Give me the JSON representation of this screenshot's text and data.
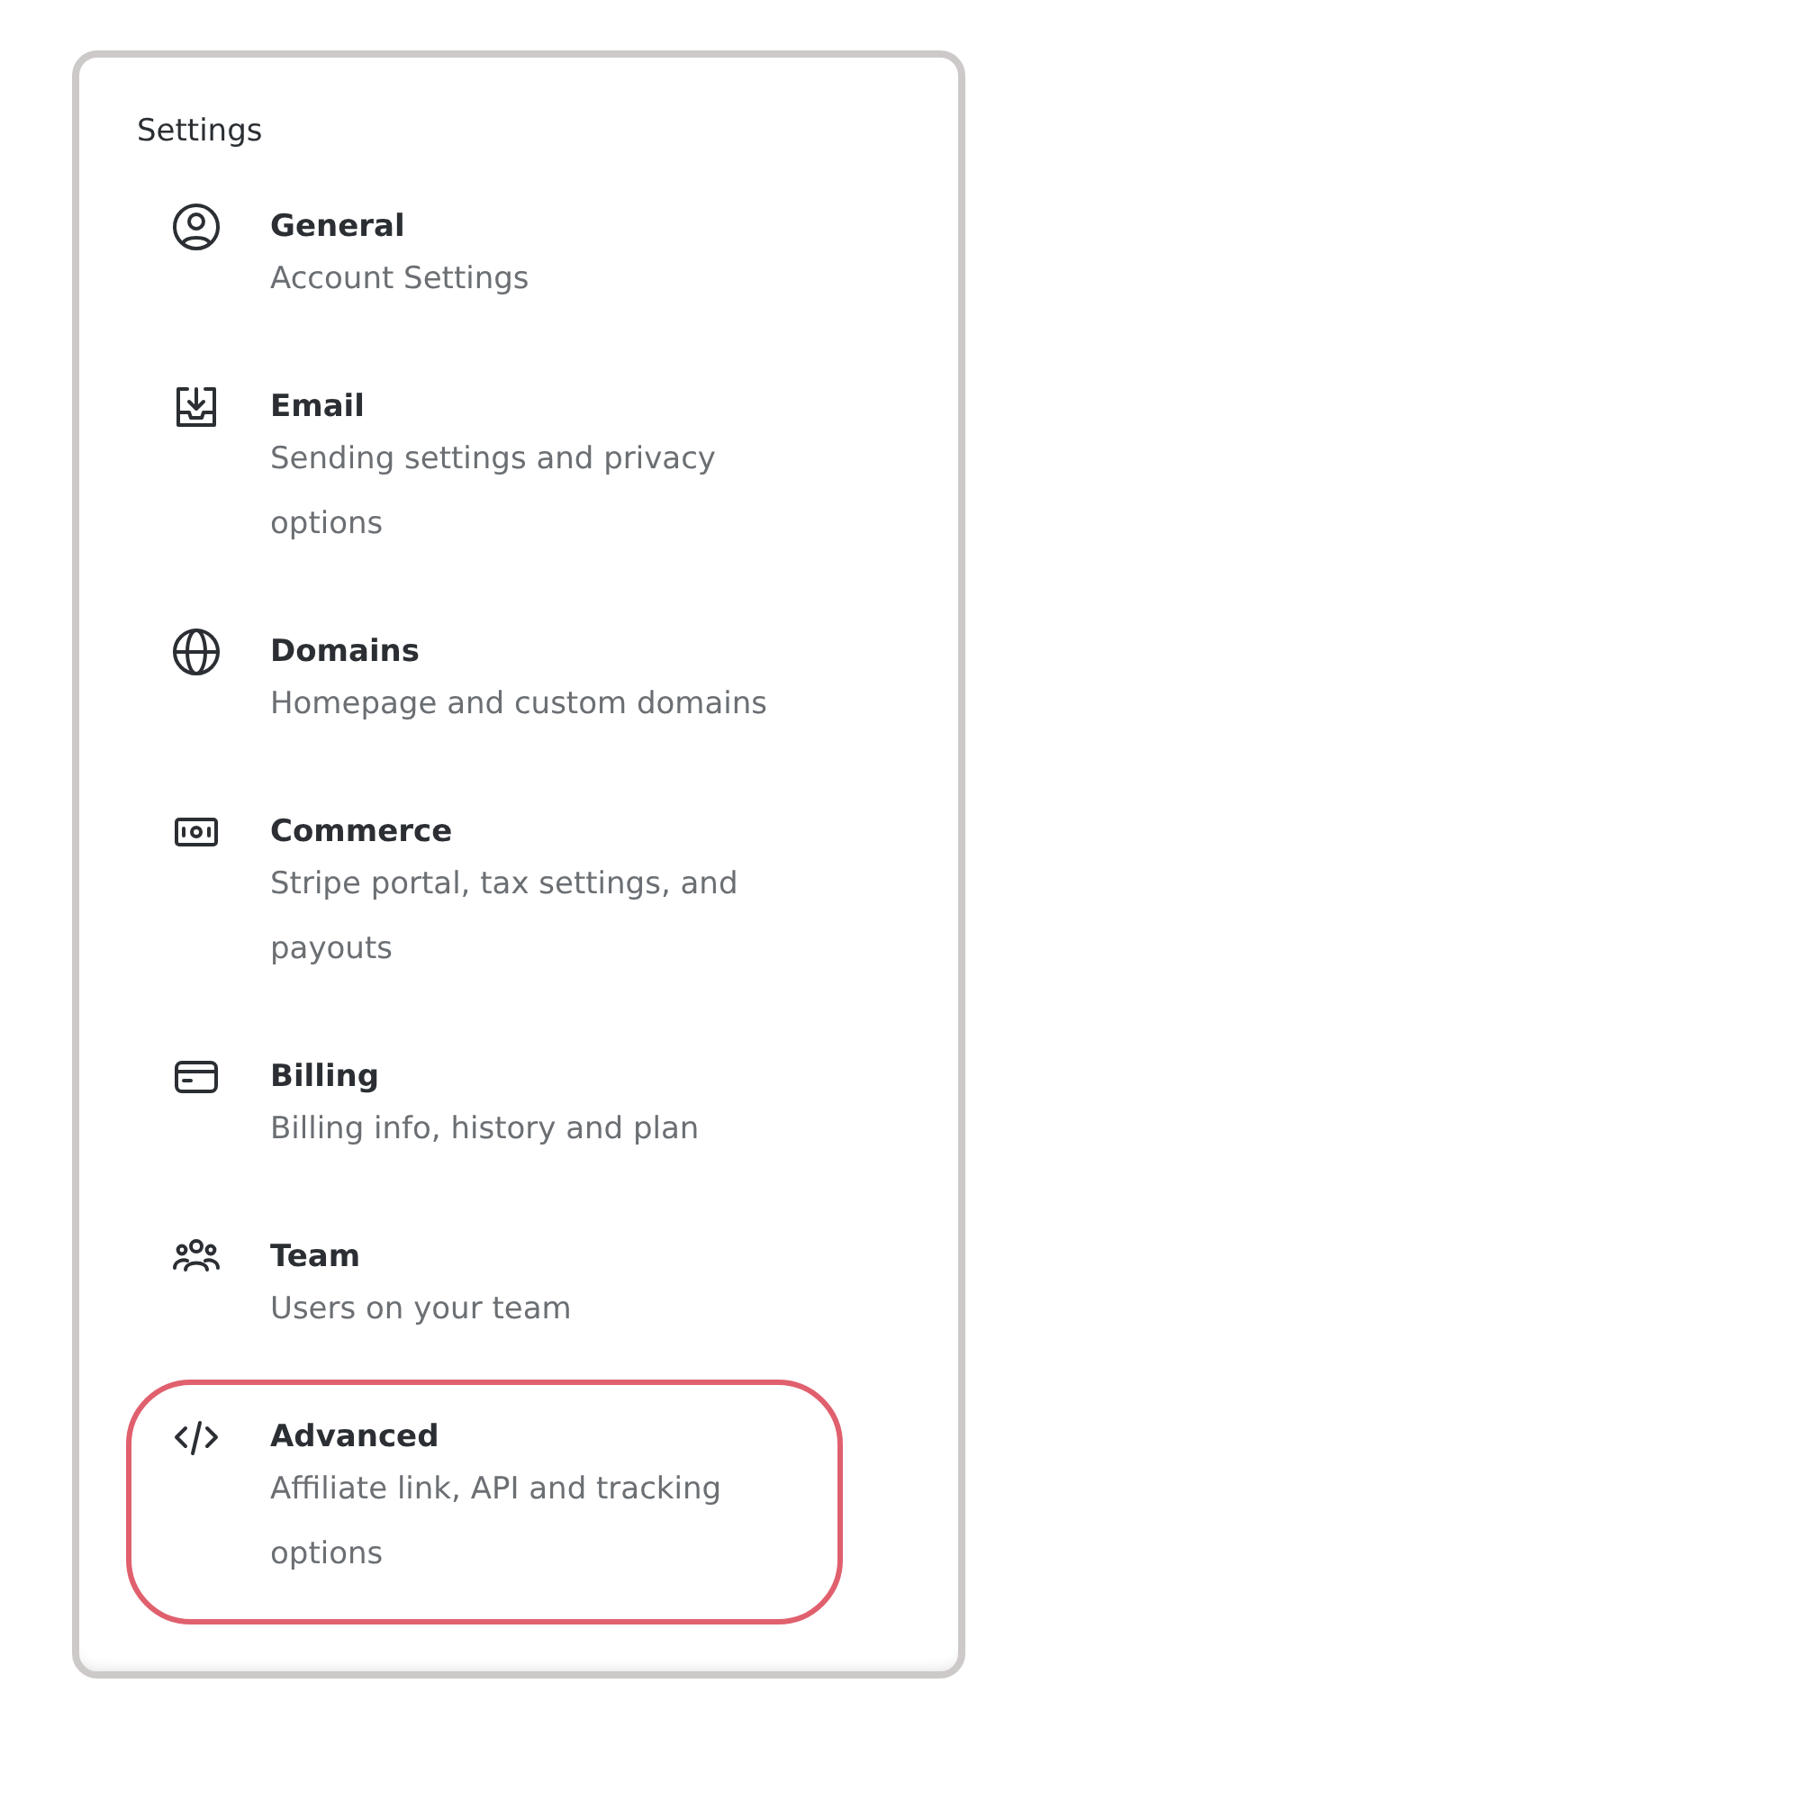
{
  "panel": {
    "title": "Settings",
    "items": [
      {
        "label": "General",
        "description": "Account Settings",
        "highlighted": false
      },
      {
        "label": "Email",
        "description": "Sending settings and privacy options",
        "highlighted": false
      },
      {
        "label": "Domains",
        "description": "Homepage and custom domains",
        "highlighted": false
      },
      {
        "label": "Commerce",
        "description": "Stripe portal, tax settings, and payouts",
        "highlighted": false
      },
      {
        "label": "Billing",
        "description": "Billing info, history and plan",
        "highlighted": false
      },
      {
        "label": "Team",
        "description": "Users on your team",
        "highlighted": false
      },
      {
        "label": "Advanced",
        "description": "Affiliate link, API and tracking options",
        "highlighted": true
      }
    ]
  }
}
